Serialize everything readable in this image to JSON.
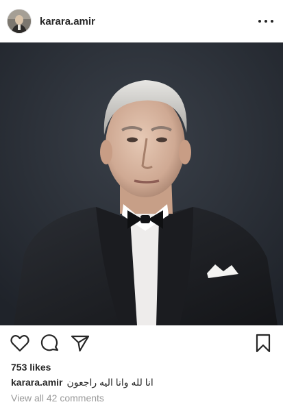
{
  "post": {
    "username": "karara.amir",
    "likes": "753 likes",
    "caption_user": "karara.amir",
    "caption_text": "انا لله وانا اليه راجعون",
    "view_comments": "View all 42 comments"
  },
  "icons": {
    "more": "more-options-icon",
    "like": "heart-icon",
    "comment": "comment-icon",
    "share": "share-icon",
    "save": "bookmark-icon"
  },
  "colors": {
    "text": "#262626",
    "muted": "#999999",
    "photo_bg": "#2b3038"
  }
}
